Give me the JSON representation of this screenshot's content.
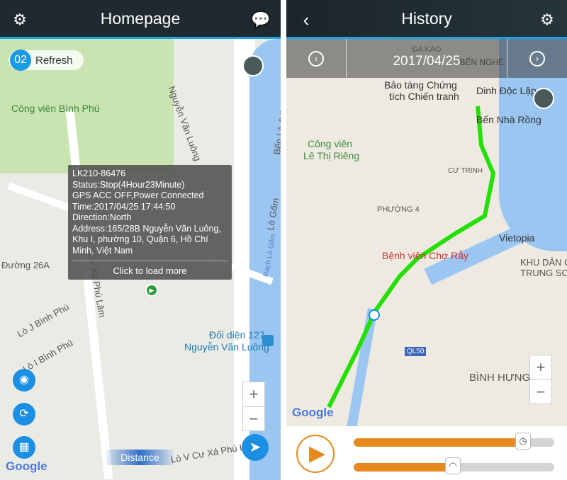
{
  "home": {
    "title": "Homepage",
    "settings_icon": "gear-icon",
    "message_icon": "message-icon",
    "refresh_count": "02",
    "refresh_label": "Refresh",
    "popup": {
      "lines": [
        "LK210-86476",
        "Status:Stop(4Hour23Minute)",
        "GPS ACC OFF,Power Connected",
        "Time:2017/04/25 17:44:50",
        "Direction:North",
        "Address:165/28B Nguyễn Văn Luông, Khu I, phường 10, Quận 6, Hồ Chí Minh, Việt Nam"
      ],
      "more": "Click to load more"
    },
    "map_labels": [
      "Công viên Bình Phú",
      "Đường 26A",
      "Lò J Bình Phú",
      "Lò I Bình Phú",
      "Bến Lò Gốm",
      "Lò Gốm",
      "Rạch Lò Gốm",
      "Đối diện 127",
      "Nguyễn Văn Luông",
      "Lò V Cư Xá Phú Lâm D",
      "Cư Xá Phú Lâm",
      "Nguyễn Văn Luông"
    ],
    "distance_label": "Distance",
    "zoom_in": "+",
    "zoom_out": "−",
    "google": "Google"
  },
  "history": {
    "title": "History",
    "back_icon": "chevron-left-icon",
    "settings_icon": "gear-icon",
    "date": "2017/04/25",
    "map_labels": [
      "ĐA KAO",
      "Bảo tàng Chứng",
      "tích Chiến tranh",
      "Dinh Độc Lập",
      "Bến Nhà Rồng",
      "Công viên",
      "Lê Thị Riêng",
      "CƯ TRINH",
      "PHƯỜNG 4",
      "Vietopia",
      "Bệnh viện Chợ Rẫy",
      "KHU DÂN CƯ",
      "TRUNG SƠN",
      "QL50",
      "BÌNH HƯNG",
      "BẾN NGHÉ"
    ],
    "zoom_in": "+",
    "zoom_out": "−",
    "google": "Google",
    "progress_percent": 82,
    "speed_percent": 47,
    "route_color": "#22e000",
    "accent": "#e8891f"
  }
}
